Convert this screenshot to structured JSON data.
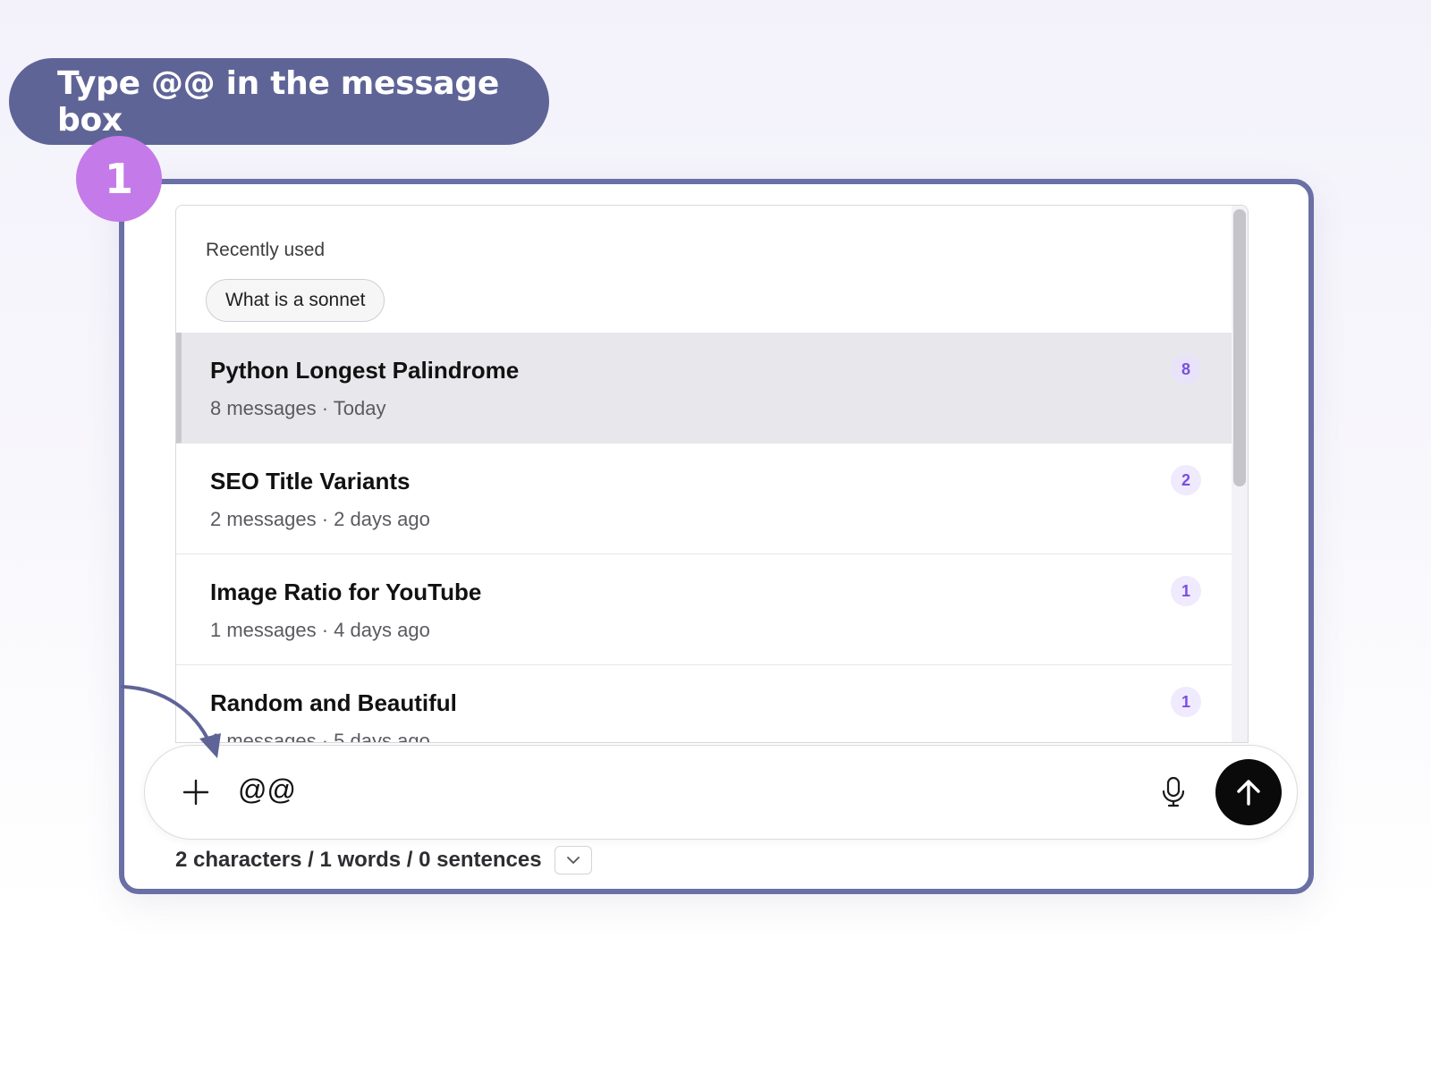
{
  "callout": {
    "text": "Type @@ in the message box"
  },
  "step": {
    "number": "1"
  },
  "dropdown": {
    "section_label": "Recently used",
    "recent_chip": "What is a sonnet",
    "conversations": [
      {
        "title": "Python Longest Palindrome",
        "meta": "8 messages · Today",
        "count": "8",
        "active": true
      },
      {
        "title": "SEO Title Variants",
        "meta": "2 messages · 2 days ago",
        "count": "2",
        "active": false
      },
      {
        "title": "Image Ratio for YouTube",
        "meta": "1 messages · 4 days ago",
        "count": "1",
        "active": false
      },
      {
        "title": "Random and Beautiful",
        "meta": "1 messages · 5 days ago",
        "count": "1",
        "active": false
      }
    ]
  },
  "input": {
    "value": "@@"
  },
  "stats": {
    "text": "2 characters / 1 words / 0 sentences"
  },
  "icons": {
    "add": "plus-icon",
    "mic": "microphone-icon",
    "send": "arrow-up-icon",
    "stats_toggle": "chevron-down-icon"
  },
  "colors": {
    "callout_bg": "#5f6497",
    "step_badge": "#c47ae8",
    "frame_border": "#6a6fa6",
    "count_badge_text": "#7a4ee0",
    "send_button": "#0a0a0a"
  }
}
